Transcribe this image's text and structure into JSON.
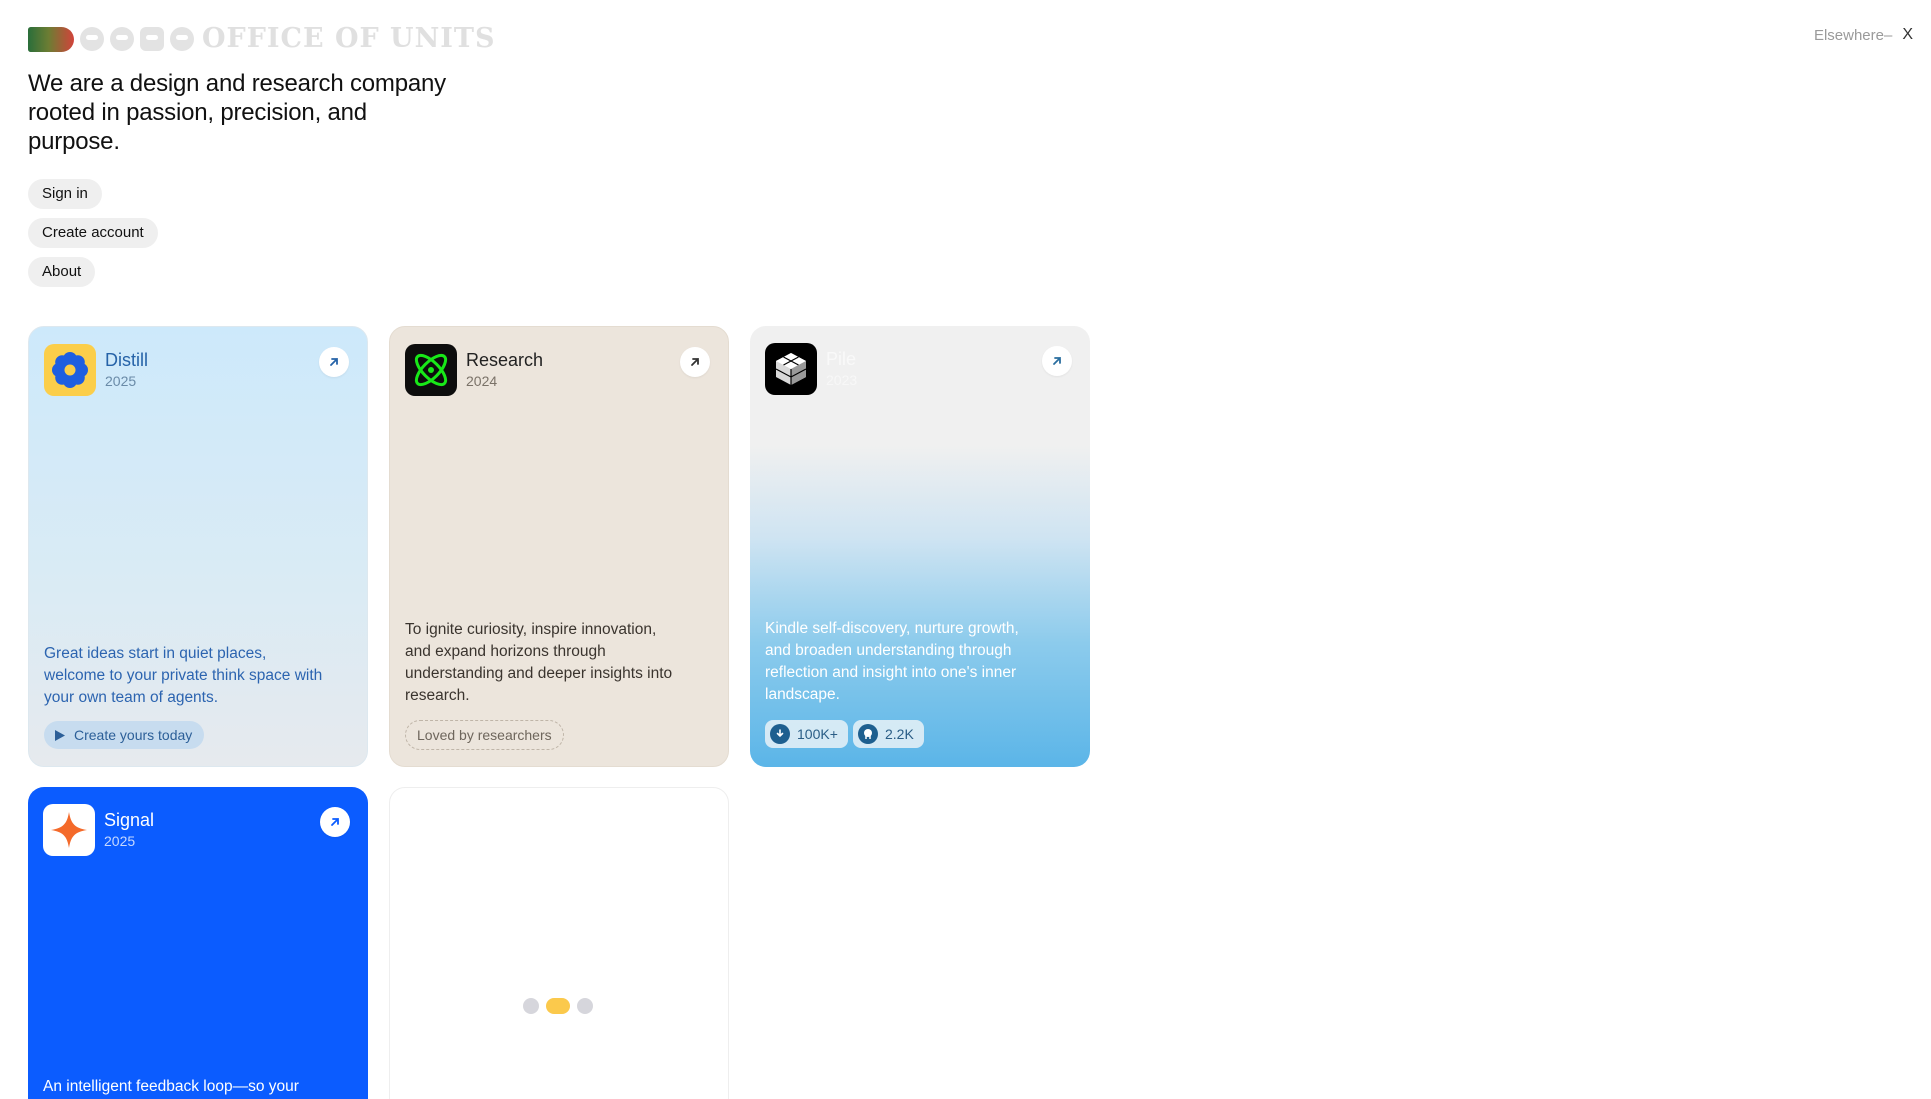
{
  "brand": {
    "name": "OFFICE OF UNITS",
    "logo_colors": [
      "#2a6e3a",
      "#6d7d33",
      "#d2433b"
    ]
  },
  "header": {
    "elsewhere_label": "Elsewhere–",
    "close_label": "X"
  },
  "intro": {
    "tagline": "We are a design and research company rooted in passion, precision, and purpose."
  },
  "nav": {
    "sign_in": "Sign in",
    "create_account": "Create account",
    "about": "About"
  },
  "cards": {
    "distill": {
      "title": "Distill",
      "year": "2025",
      "description": "Great ideas start in quiet places, welcome to your private think space with your own team of agents.",
      "cta": "Create yours today",
      "icon": "flower-icon",
      "accent": "#2663a8"
    },
    "research": {
      "title": "Research",
      "year": "2024",
      "description": "To ignite curiosity, inspire innovation, and expand horizons through understanding and deeper insights into research.",
      "badge": "Loved by researchers",
      "icon": "atom-icon",
      "accent": "#18e818"
    },
    "pile": {
      "title": "Pile",
      "year": "2023",
      "description": "Kindle self-discovery, nurture growth, and broaden understanding through reflection and insight into one's inner landscape.",
      "downloads": "100K+",
      "stars": "2.2K",
      "icon": "cube-stack-icon",
      "accent": "#5bb5e8"
    },
    "signal": {
      "title": "Signal",
      "year": "2025",
      "description": "An intelligent feedback loop—so your",
      "icon": "sparkle-icon",
      "accent": "#0b5cff"
    }
  },
  "loading": {
    "dot_count": 3,
    "active_index": 1,
    "active_color": "#fbc94c"
  }
}
